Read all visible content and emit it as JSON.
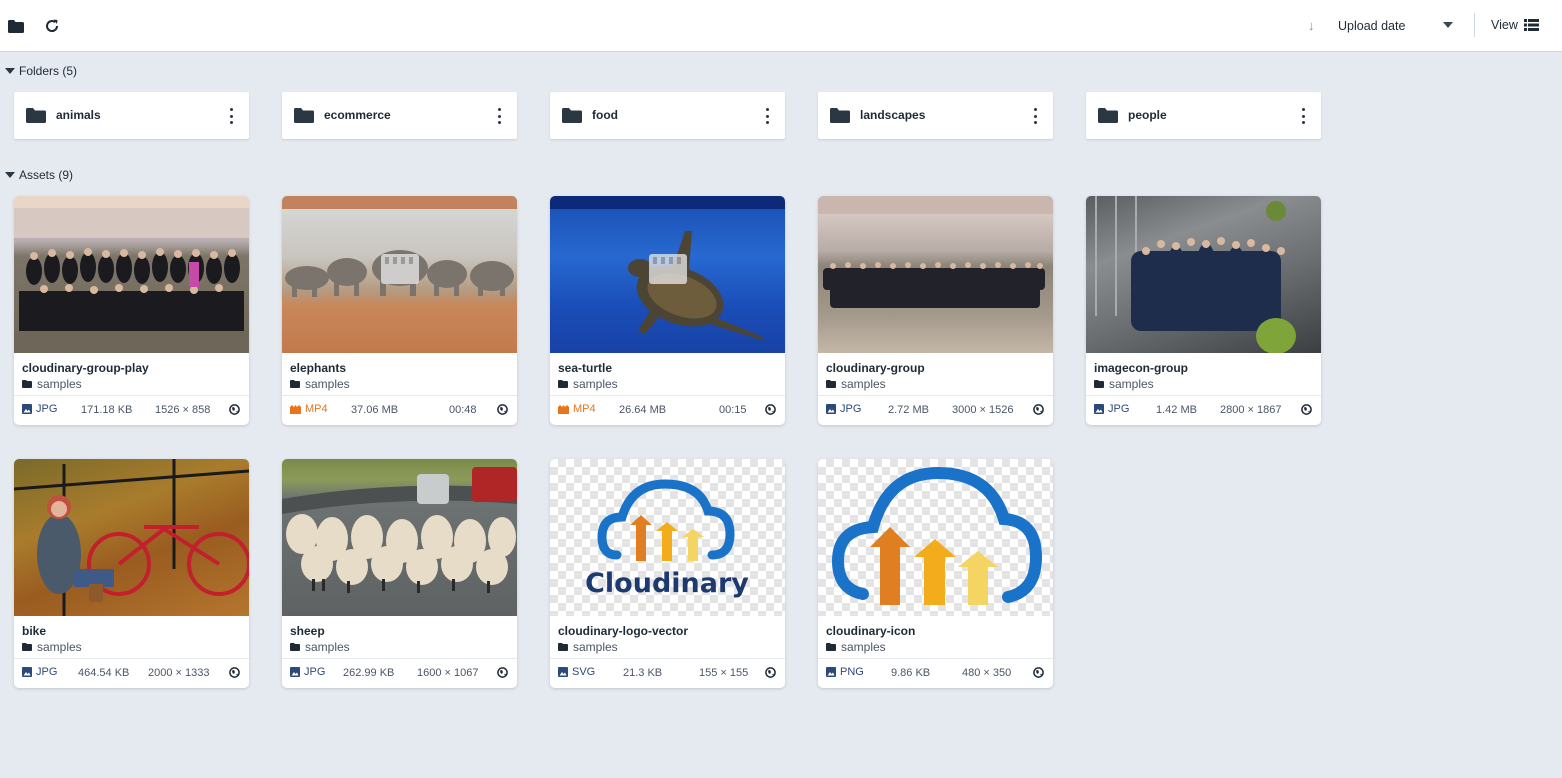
{
  "toolbar": {
    "folder_icon": "folder-icon",
    "refresh_icon": "refresh-icon",
    "sort_arrow": "↓",
    "sort_label": "Upload date",
    "view_label": "View",
    "view_icon": "list-view-icon"
  },
  "folders_section": {
    "label": "Folders (5)",
    "items": [
      {
        "name": "animals"
      },
      {
        "name": "ecommerce"
      },
      {
        "name": "food"
      },
      {
        "name": "landscapes"
      },
      {
        "name": "people"
      }
    ]
  },
  "assets_section": {
    "label": "Assets (9)",
    "items": [
      {
        "name": "cloudinary-group-play",
        "folder": "samples",
        "type": "JPG",
        "kind": "image",
        "size": "171.18 KB",
        "extra": "1526 × 858"
      },
      {
        "name": "elephants",
        "folder": "samples",
        "type": "MP4",
        "kind": "video",
        "size": "37.06 MB",
        "extra": "00:48"
      },
      {
        "name": "sea-turtle",
        "folder": "samples",
        "type": "MP4",
        "kind": "video",
        "size": "26.64 MB",
        "extra": "00:15"
      },
      {
        "name": "cloudinary-group",
        "folder": "samples",
        "type": "JPG",
        "kind": "image",
        "size": "2.72 MB",
        "extra": "3000 × 1526"
      },
      {
        "name": "imagecon-group",
        "folder": "samples",
        "type": "JPG",
        "kind": "image",
        "size": "1.42 MB",
        "extra": "2800 × 1867"
      },
      {
        "name": "bike",
        "folder": "samples",
        "type": "JPG",
        "kind": "image",
        "size": "464.54 KB",
        "extra": "2000 × 1333"
      },
      {
        "name": "sheep",
        "folder": "samples",
        "type": "JPG",
        "kind": "image",
        "size": "262.99 KB",
        "extra": "1600 × 1067"
      },
      {
        "name": "cloudinary-logo-vector",
        "folder": "samples",
        "type": "SVG",
        "kind": "image",
        "size": "21.3 KB",
        "extra": "155 × 155"
      },
      {
        "name": "cloudinary-icon",
        "folder": "samples",
        "type": "PNG",
        "kind": "image",
        "size": "9.86 KB",
        "extra": "480 × 350"
      }
    ]
  },
  "logo_text": "Cloudinary",
  "colors": {
    "image_type": "#2b4a7a",
    "video_type": "#e8741c",
    "background": "#e5eaf0",
    "cloud_blue": "#1a73c8"
  }
}
